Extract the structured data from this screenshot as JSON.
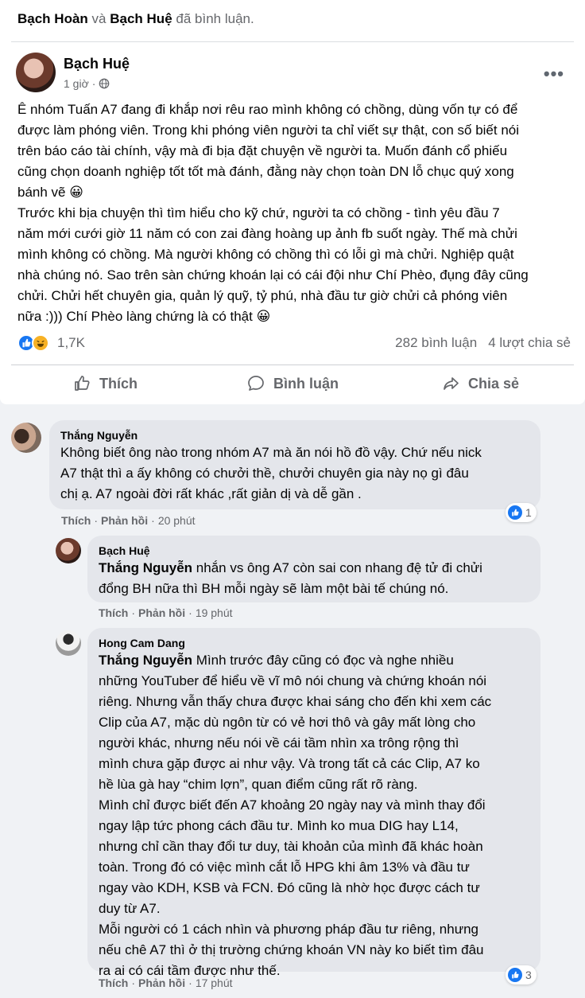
{
  "activity": {
    "user1": "Bạch Hoàn",
    "conj": "và",
    "user2": "Bạch Huệ",
    "suffix": "đã bình luận."
  },
  "post": {
    "author": "Bạch Huệ",
    "time": "1 giờ",
    "dot": "·",
    "body": "Ê nhóm Tuấn A7 đang đi khắp nơi rêu rao mình không có chồng, dùng vốn tự có để\nđược làm phóng viên. Trong khi phóng viên người ta chỉ viết sự thật, con số biết nói\ntrên báo cáo tài chính, vậy mà đi bịa đặt chuyện về người ta. Muốn đánh cổ phiếu\ncũng chọn doanh nghiệp tốt tốt mà đánh, đằng này chọn toàn DN lỗ chục quý xong\nbánh vẽ 😀\nTrước khi bịa chuyện thì tìm hiểu cho kỹ chứ, người ta có chồng - tình yêu đầu 7\nnăm mới cưới giờ 11 năm có con zai đàng hoàng up ảnh fb suốt ngày. Thế mà chửi\nmình không có chồng. Mà người không có chồng thì có lỗi gì mà chửi. Nghiệp quật\nnhà chúng nó. Sao trên sàn chứng khoán lại có cái đội như Chí Phèo, đụng đây cũng\nchửi. Chửi hết chuyên gia, quản lý quỹ, tỷ phú, nhà đầu tư giờ chửi cả phóng viên\nnữa :))) Chí Phèo làng chứng là có thật 😀",
    "reaction_count": "1,7K",
    "comments_count": "282 bình luận",
    "shares_count": "4 lượt chia sẻ"
  },
  "actions": {
    "like": "Thích",
    "comment": "Bình luận",
    "share": "Chia sẻ"
  },
  "comments": [
    {
      "name": "Thắng Nguyễn",
      "mention": "",
      "text": "Không biết ông nào trong nhóm A7 mà ăn nói hồ đồ vậy. Chứ nếu nick\nA7 thật thì a ấy không có chưởi thề, chưởi chuyên gia này nọ gì đâu\nchị ạ. A7 ngoài đời rất khác ,rất giản dị và dễ gần .",
      "like": "Thích",
      "reply": "Phản hồi",
      "time": "20 phút",
      "reactions": "1"
    },
    {
      "name": "Bạch Huệ",
      "mention": "Thắng Nguyễn",
      "text": " nhắn vs ông A7 còn sai con nhang đệ tử đi chửi\nđổng BH nữa thì BH mỗi ngày sẽ làm một bài tế chúng nó.",
      "like": "Thích",
      "reply": "Phản hồi",
      "time": "19 phút",
      "reactions": ""
    },
    {
      "name": "Hong Cam Dang",
      "mention": "Thắng Nguyễn",
      "text": " Mình trước đây cũng có đọc và nghe nhiều\nnhững YouTuber để hiểu về vĩ mô nói chung và chứng khoán nói\nriêng. Nhưng vẫn thấy chưa được khai sáng cho đến khi xem các\nClip của A7, mặc dù ngôn từ có vẻ hơi thô và gây mất lòng cho\nngười khác, nhưng nếu nói về cái tầm nhìn xa trông rộng thì\nmình chưa gặp được ai như vậy. Và trong tất cả các Clip, A7 ko\nhề lùa gà hay “chim lợn”, quan điểm cũng rất rõ ràng.\nMình chỉ được biết đến A7 khoảng 20 ngày nay và mình thay đổi\nngay lập tức phong cách đầu tư. Mình ko mua DIG hay L14,\nnhưng chỉ cần thay đổi tư duy, tài khoản của mình đã khác hoàn\ntoàn. Trong đó có việc mình cắt lỗ HPG khi âm 13% và đầu tư\nngay vào KDH, KSB và FCN. Đó cũng là nhờ học được cách tư\nduy từ A7.\nMỗi người có 1 cách nhìn và phương pháp đầu tư riêng, nhưng\nnếu chê A7 thì ở thị trường chứng khoán VN này ko biết tìm đâu\nra ai có cái tầm được như thế.",
      "like": "Thích",
      "reply": "Phản hồi",
      "time": "17 phút",
      "reactions": "3"
    }
  ]
}
